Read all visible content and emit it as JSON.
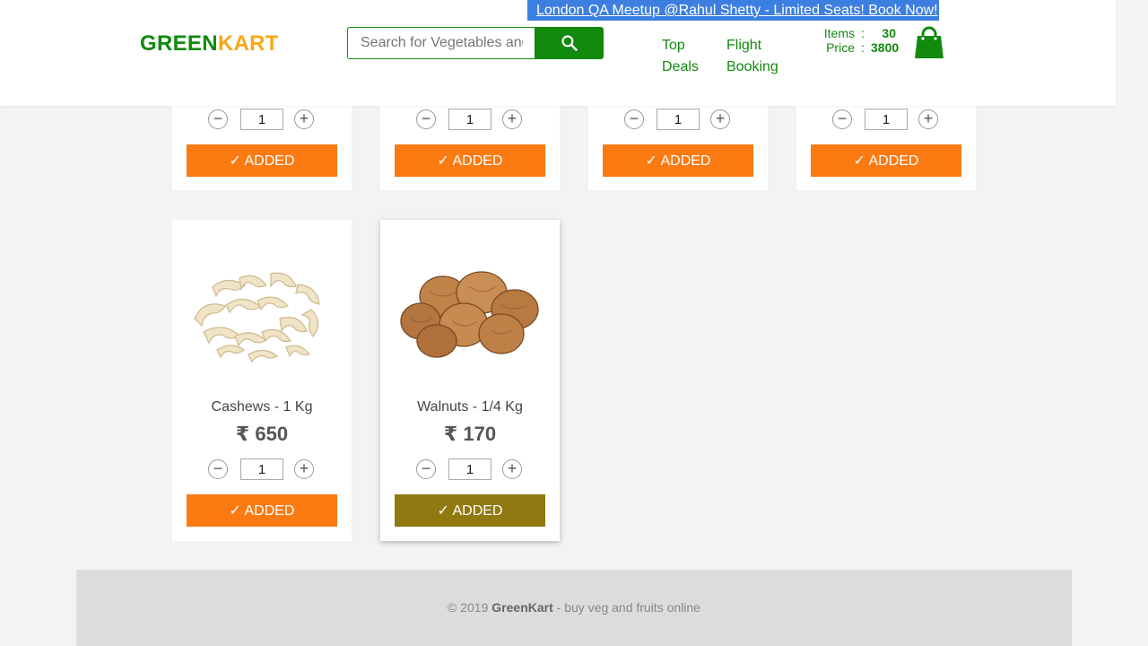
{
  "header": {
    "promo": "London QA Meetup @Rahul Shetty - Limited Seats! Book Now!",
    "brand_green": "GREEN",
    "brand_orange": "KART",
    "search_placeholder": "Search for Vegetables and Fruits",
    "search_icon": "search-icon",
    "nav": {
      "top_deals_1": "Top",
      "top_deals_2": "Deals",
      "flight_1": "Flight",
      "flight_2": "Booking"
    },
    "cart": {
      "items_label": "Items",
      "items_sep": ":",
      "items_value": "30",
      "price_label": "Price",
      "price_sep": ":",
      "price_value": "3800",
      "icon": "shopping-bag-icon"
    }
  },
  "top_row": [
    {
      "qty": "1",
      "button": "✓ ADDED"
    },
    {
      "qty": "1",
      "button": "✓ ADDED"
    },
    {
      "qty": "1",
      "button": "✓ ADDED"
    },
    {
      "qty": "1",
      "button": "✓ ADDED"
    }
  ],
  "products": [
    {
      "name": "Cashews - 1 Kg",
      "price": "₹ 650",
      "qty": "1",
      "button": "✓ ADDED"
    },
    {
      "name": "Walnuts - 1/4 Kg",
      "price": "₹ 170",
      "qty": "1",
      "button": "✓ ADDED"
    }
  ],
  "stepper": {
    "minus": "−",
    "plus": "+"
  },
  "footer": {
    "copyright": "© 2019 ",
    "brand": "GreenKart",
    "tagline": " - buy veg and fruits online"
  },
  "colors": {
    "brand_green": "#118a0d",
    "brand_orange": "#f6a914",
    "added_orange": "#fc7a12",
    "added_olive": "#917912",
    "promo_blue": "#3d7fe0"
  }
}
